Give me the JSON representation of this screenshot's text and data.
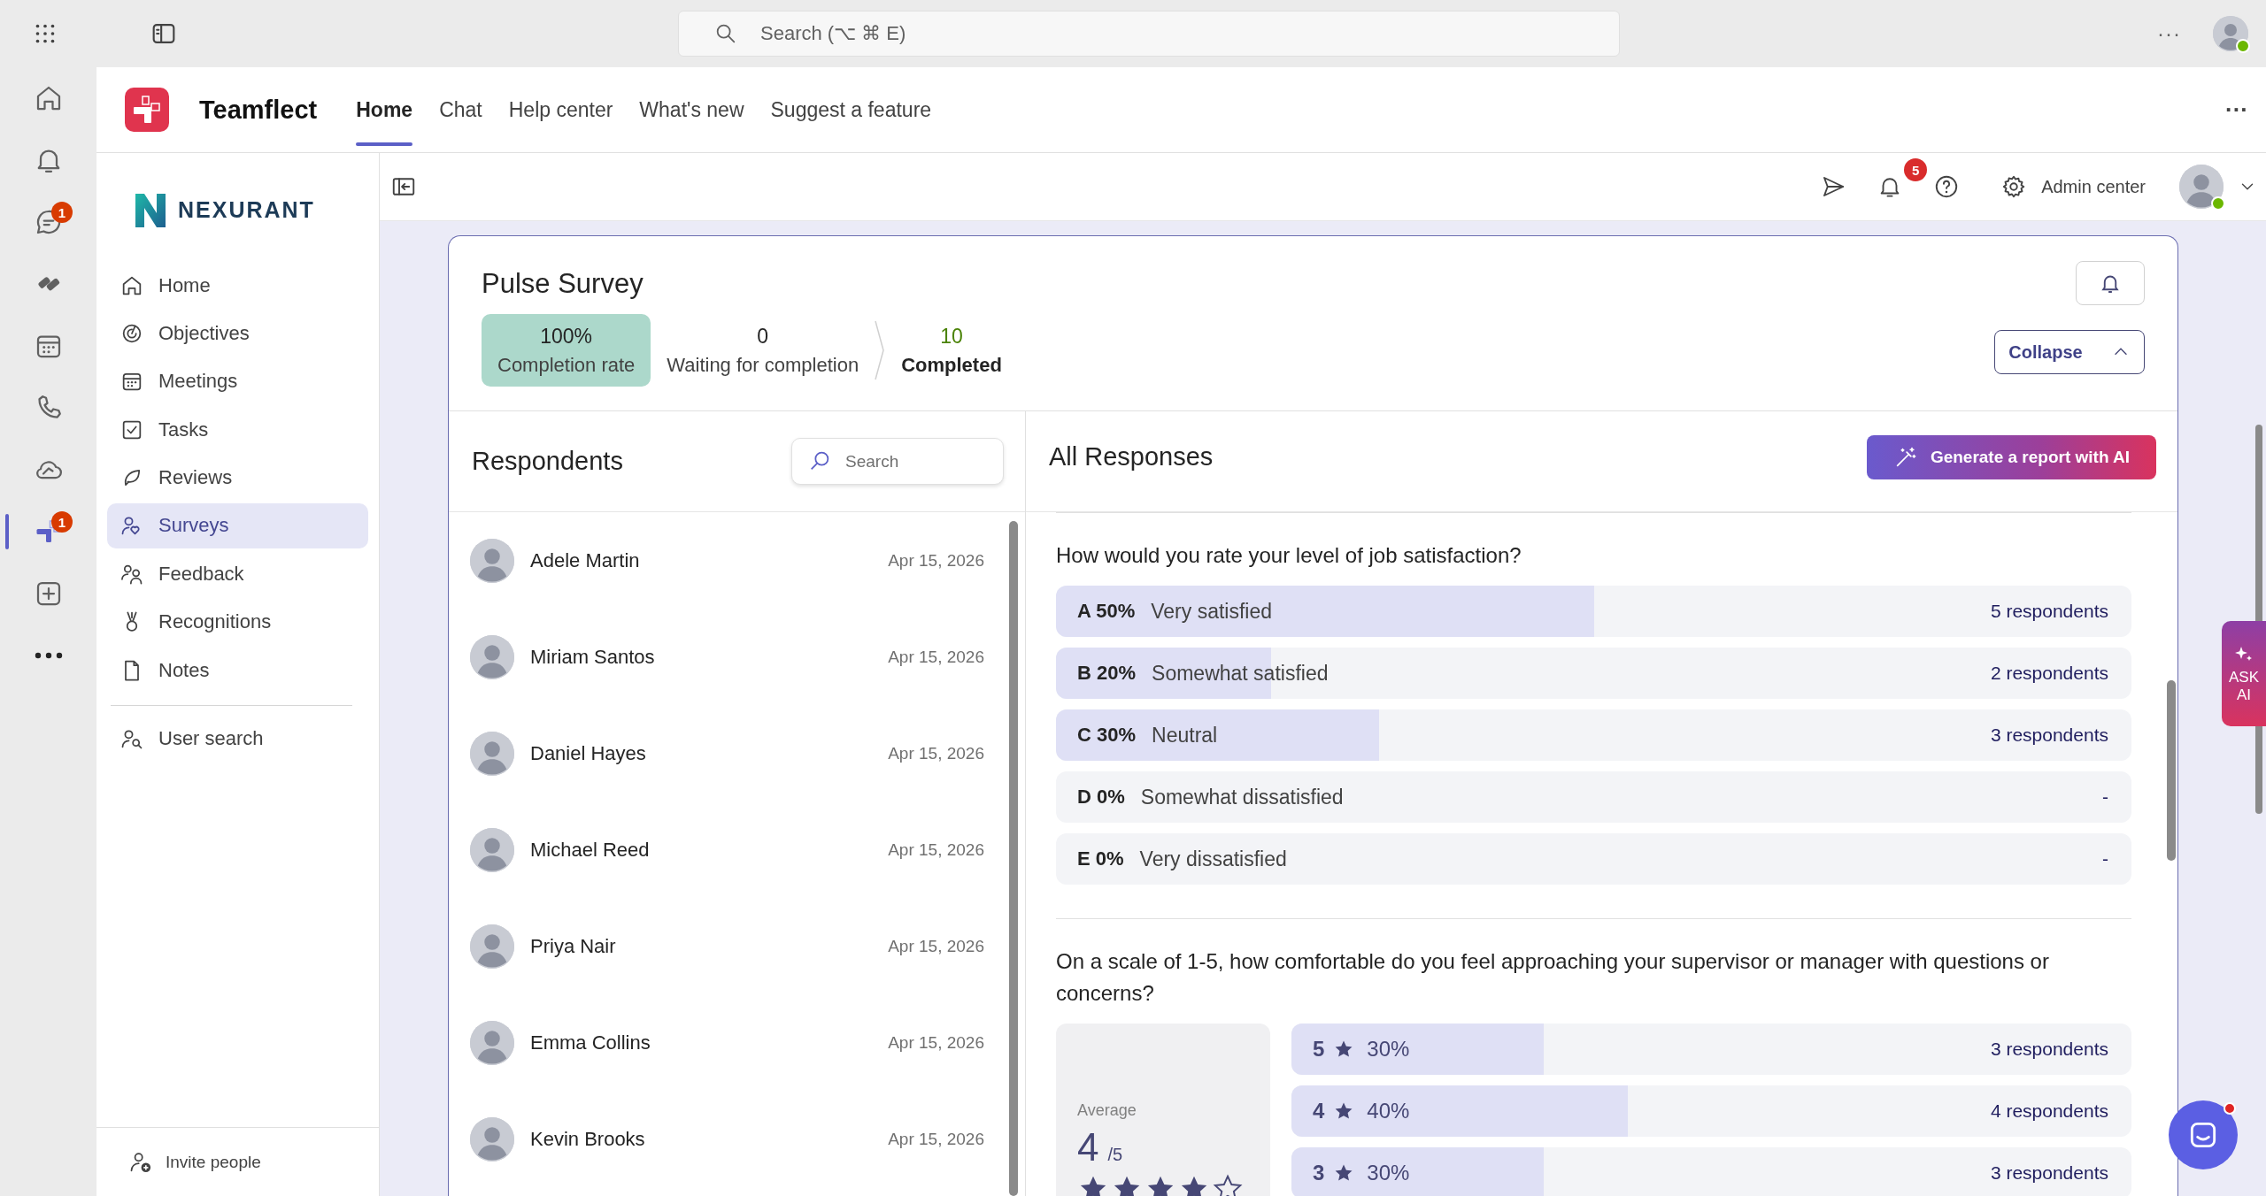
{
  "top_bar": {
    "search": {
      "placeholder": "Search (⌥ ⌘ E)"
    },
    "more": "···"
  },
  "rail": {
    "items": [
      {
        "kind": "home",
        "selected": false
      },
      {
        "kind": "bell",
        "selected": false
      },
      {
        "kind": "chat",
        "badge": "1",
        "selected": false
      },
      {
        "kind": "tiles",
        "selected": false
      },
      {
        "kind": "calendar",
        "selected": false
      },
      {
        "kind": "phone",
        "selected": false
      },
      {
        "kind": "cloud",
        "selected": false
      },
      {
        "kind": "app",
        "badge": "1",
        "selected": true
      },
      {
        "kind": "add",
        "selected": false
      },
      {
        "kind": "more",
        "selected": false
      }
    ]
  },
  "app": {
    "name": "Teamflect",
    "tabs": [
      {
        "label": "Home",
        "selected": true
      },
      {
        "label": "Chat",
        "selected": false
      },
      {
        "label": "Help center",
        "selected": false
      },
      {
        "label": "What's new",
        "selected": false
      },
      {
        "label": "Suggest a feature",
        "selected": false
      }
    ]
  },
  "sidebar": {
    "org": "NEXURANT",
    "items": [
      {
        "kind": "home",
        "label": "Home",
        "selected": false
      },
      {
        "kind": "target",
        "label": "Objectives",
        "selected": false
      },
      {
        "kind": "calendar",
        "label": "Meetings",
        "selected": false
      },
      {
        "kind": "check",
        "label": "Tasks",
        "selected": false
      },
      {
        "kind": "leaf",
        "label": "Reviews",
        "selected": false
      },
      {
        "kind": "survey",
        "label": "Surveys",
        "selected": true
      },
      {
        "kind": "people",
        "label": "Feedback",
        "selected": false
      },
      {
        "kind": "medal",
        "label": "Recognitions",
        "selected": false
      },
      {
        "kind": "page",
        "label": "Notes",
        "selected": false
      }
    ],
    "extra_items": [
      {
        "kind": "usersearch",
        "label": "User search",
        "selected": false
      }
    ],
    "invite": "Invite people"
  },
  "toolbar": {
    "notifications_badge": "5",
    "admin_label": "Admin center"
  },
  "survey": {
    "title": "Pulse Survey",
    "collapse_label": "Collapse",
    "stats": [
      {
        "value": "100%",
        "label": "Completion rate",
        "highlighted": true,
        "color": "#242424"
      },
      {
        "value": "0",
        "label": "Waiting for completion",
        "highlighted": false,
        "color": "#242424"
      },
      {
        "value": "10",
        "label": "Completed",
        "highlighted": false,
        "color": "#498205"
      }
    ]
  },
  "respondents": {
    "title": "Respondents",
    "search": {
      "placeholder": "Search"
    },
    "rows": [
      {
        "name": "Adele Martin",
        "date": "Apr 15, 2026"
      },
      {
        "name": "Miriam Santos",
        "date": "Apr 15, 2026"
      },
      {
        "name": "Daniel Hayes",
        "date": "Apr 15, 2026"
      },
      {
        "name": "Michael Reed",
        "date": "Apr 15, 2026"
      },
      {
        "name": "Priya Nair",
        "date": "Apr 15, 2026"
      },
      {
        "name": "Emma Collins",
        "date": "Apr 15, 2026"
      },
      {
        "name": "Kevin Brooks",
        "date": "Apr 15, 2026"
      }
    ]
  },
  "responses": {
    "title": "All Responses",
    "ai_button": "Generate a report with AI",
    "questions": [
      {
        "kind": "choice",
        "text": "How would you rate your level of job satisfaction?",
        "options": [
          {
            "tag": "A 50%",
            "label": "Very satisfied",
            "count": "5 respondents",
            "level": 0.5
          },
          {
            "tag": "B 20%",
            "label": "Somewhat satisfied",
            "count": "2 respondents",
            "level": 0.2
          },
          {
            "tag": "C 30%",
            "label": "Neutral",
            "count": "3 respondents",
            "level": 0.3
          },
          {
            "tag": "D 0%",
            "label": "Somewhat dissatisfied",
            "count": "-",
            "level": 0
          },
          {
            "tag": "E 0%",
            "label": "Very dissatisfied",
            "count": "-",
            "level": 0
          }
        ]
      },
      {
        "kind": "rating",
        "text": "On a scale of 1-5, how comfortable do you feel approaching your supervisor or manager with questions or concerns?",
        "average": {
          "label": "Average",
          "value": "4",
          "max": "/5",
          "stars": 4
        },
        "options": [
          {
            "score": "5",
            "percent": "30%",
            "count": "3 respondents",
            "level": 0.3
          },
          {
            "score": "4",
            "percent": "40%",
            "count": "4 respondents",
            "level": 0.4
          },
          {
            "score": "3",
            "percent": "30%",
            "count": "3 respondents",
            "level": 0.3
          }
        ]
      }
    ]
  },
  "ask_ai": {
    "label": "ASK AI"
  },
  "chat_launcher": {
    "unread": true
  }
}
